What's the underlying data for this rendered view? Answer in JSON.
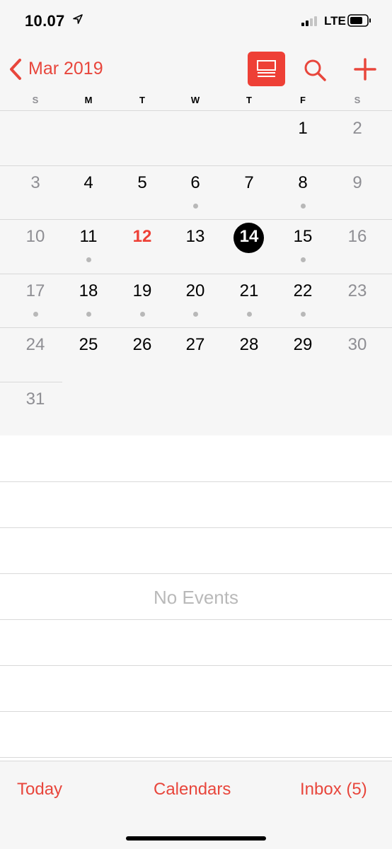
{
  "status_bar": {
    "time": "10.07",
    "carrier": "LTE",
    "icons": [
      "location-arrow-icon",
      "signal-bars-icon",
      "battery-icon"
    ]
  },
  "nav": {
    "back_label": "Mar 2019",
    "icons": [
      "chevron-left-icon",
      "list-view-icon",
      "search-icon",
      "plus-icon"
    ]
  },
  "weekdays": [
    "S",
    "M",
    "T",
    "W",
    "T",
    "F",
    "S"
  ],
  "calendar": {
    "month": "Mar 2019",
    "today": 12,
    "selected": 14,
    "days": [
      {
        "day": "1",
        "col": 5,
        "row": 0,
        "weekend": false,
        "dot": false
      },
      {
        "day": "2",
        "col": 6,
        "row": 0,
        "weekend": true,
        "dot": false
      },
      {
        "day": "3",
        "col": 0,
        "row": 1,
        "weekend": true,
        "dot": false
      },
      {
        "day": "4",
        "col": 1,
        "row": 1,
        "weekend": false,
        "dot": false
      },
      {
        "day": "5",
        "col": 2,
        "row": 1,
        "weekend": false,
        "dot": false
      },
      {
        "day": "6",
        "col": 3,
        "row": 1,
        "weekend": false,
        "dot": true
      },
      {
        "day": "7",
        "col": 4,
        "row": 1,
        "weekend": false,
        "dot": false
      },
      {
        "day": "8",
        "col": 5,
        "row": 1,
        "weekend": false,
        "dot": true
      },
      {
        "day": "9",
        "col": 6,
        "row": 1,
        "weekend": true,
        "dot": false
      },
      {
        "day": "10",
        "col": 0,
        "row": 2,
        "weekend": true,
        "dot": false
      },
      {
        "day": "11",
        "col": 1,
        "row": 2,
        "weekend": false,
        "dot": true
      },
      {
        "day": "12",
        "col": 2,
        "row": 2,
        "weekend": false,
        "dot": false
      },
      {
        "day": "13",
        "col": 3,
        "row": 2,
        "weekend": false,
        "dot": false
      },
      {
        "day": "14",
        "col": 4,
        "row": 2,
        "weekend": false,
        "dot": false
      },
      {
        "day": "15",
        "col": 5,
        "row": 2,
        "weekend": false,
        "dot": true
      },
      {
        "day": "16",
        "col": 6,
        "row": 2,
        "weekend": true,
        "dot": false
      },
      {
        "day": "17",
        "col": 0,
        "row": 3,
        "weekend": true,
        "dot": true
      },
      {
        "day": "18",
        "col": 1,
        "row": 3,
        "weekend": false,
        "dot": true
      },
      {
        "day": "19",
        "col": 2,
        "row": 3,
        "weekend": false,
        "dot": true
      },
      {
        "day": "20",
        "col": 3,
        "row": 3,
        "weekend": false,
        "dot": true
      },
      {
        "day": "21",
        "col": 4,
        "row": 3,
        "weekend": false,
        "dot": true
      },
      {
        "day": "22",
        "col": 5,
        "row": 3,
        "weekend": false,
        "dot": true
      },
      {
        "day": "23",
        "col": 6,
        "row": 3,
        "weekend": true,
        "dot": false
      },
      {
        "day": "24",
        "col": 0,
        "row": 4,
        "weekend": true,
        "dot": false
      },
      {
        "day": "25",
        "col": 1,
        "row": 4,
        "weekend": false,
        "dot": false
      },
      {
        "day": "26",
        "col": 2,
        "row": 4,
        "weekend": false,
        "dot": false
      },
      {
        "day": "27",
        "col": 3,
        "row": 4,
        "weekend": false,
        "dot": false
      },
      {
        "day": "28",
        "col": 4,
        "row": 4,
        "weekend": false,
        "dot": false
      },
      {
        "day": "29",
        "col": 5,
        "row": 4,
        "weekend": false,
        "dot": false
      },
      {
        "day": "30",
        "col": 6,
        "row": 4,
        "weekend": true,
        "dot": false
      },
      {
        "day": "31",
        "col": 0,
        "row": 5,
        "weekend": true,
        "dot": false
      }
    ]
  },
  "events": {
    "empty_label": "No Events"
  },
  "tab_bar": {
    "today_label": "Today",
    "calendars_label": "Calendars",
    "inbox_label": "Inbox (5)"
  },
  "colors": {
    "accent": "#ee4036",
    "background": "#f6f6f6",
    "weekend_text": "#8e8e93",
    "event_dot": "#b8b8b8"
  }
}
